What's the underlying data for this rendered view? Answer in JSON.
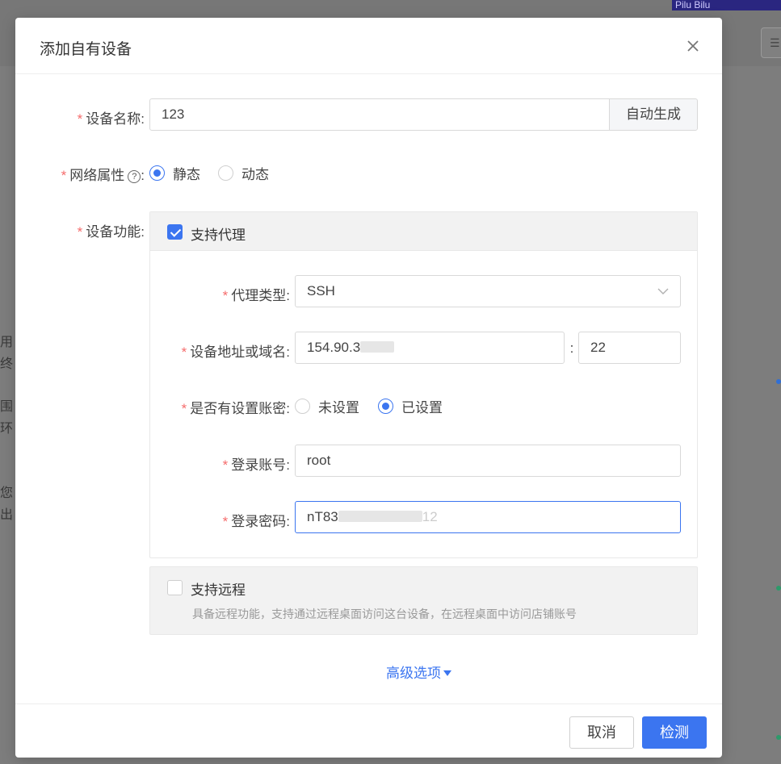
{
  "background": {
    "banner_text": "Pilu Bilu",
    "menu_icon": "list-icon",
    "side_texts": [
      "用",
      "终",
      "围",
      "环",
      "您",
      "出"
    ]
  },
  "modal": {
    "title": "添加自有设备",
    "close_icon": "close-icon"
  },
  "form": {
    "device_name": {
      "label": "设备名称:",
      "value": "123",
      "append_button": "自动生成"
    },
    "network": {
      "label": "网络属性",
      "colon": ":",
      "help_icon": "question-circle-icon",
      "options": [
        {
          "label": "静态",
          "selected": true
        },
        {
          "label": "动态",
          "selected": false
        }
      ]
    },
    "function": {
      "label": "设备功能:",
      "proxy": {
        "label": "支持代理",
        "checked": true,
        "proxy_type": {
          "label": "代理类型:",
          "value": "SSH",
          "icon": "chevron-down-icon"
        },
        "address": {
          "label": "设备地址或域名:",
          "value": "154.90.3",
          "separator": ":",
          "port": "22"
        },
        "has_account": {
          "label": "是否有设置账密:",
          "options": [
            {
              "label": "未设置",
              "selected": false
            },
            {
              "label": "已设置",
              "selected": true
            }
          ]
        },
        "login_account": {
          "label": "登录账号:",
          "value": "root"
        },
        "login_password": {
          "label": "登录密码:",
          "value": "nT83",
          "tail": "12"
        }
      },
      "remote": {
        "label": "支持远程",
        "checked": false,
        "description": "具备远程功能，支持通过远程桌面访问这台设备，在远程桌面中访问店铺账号"
      }
    },
    "advanced": {
      "label": "高级选项",
      "icon": "caret-down-icon"
    }
  },
  "footer": {
    "cancel": "取消",
    "detect": "检测"
  },
  "colors": {
    "primary": "#3b75f0",
    "required": "#f56c6c"
  }
}
